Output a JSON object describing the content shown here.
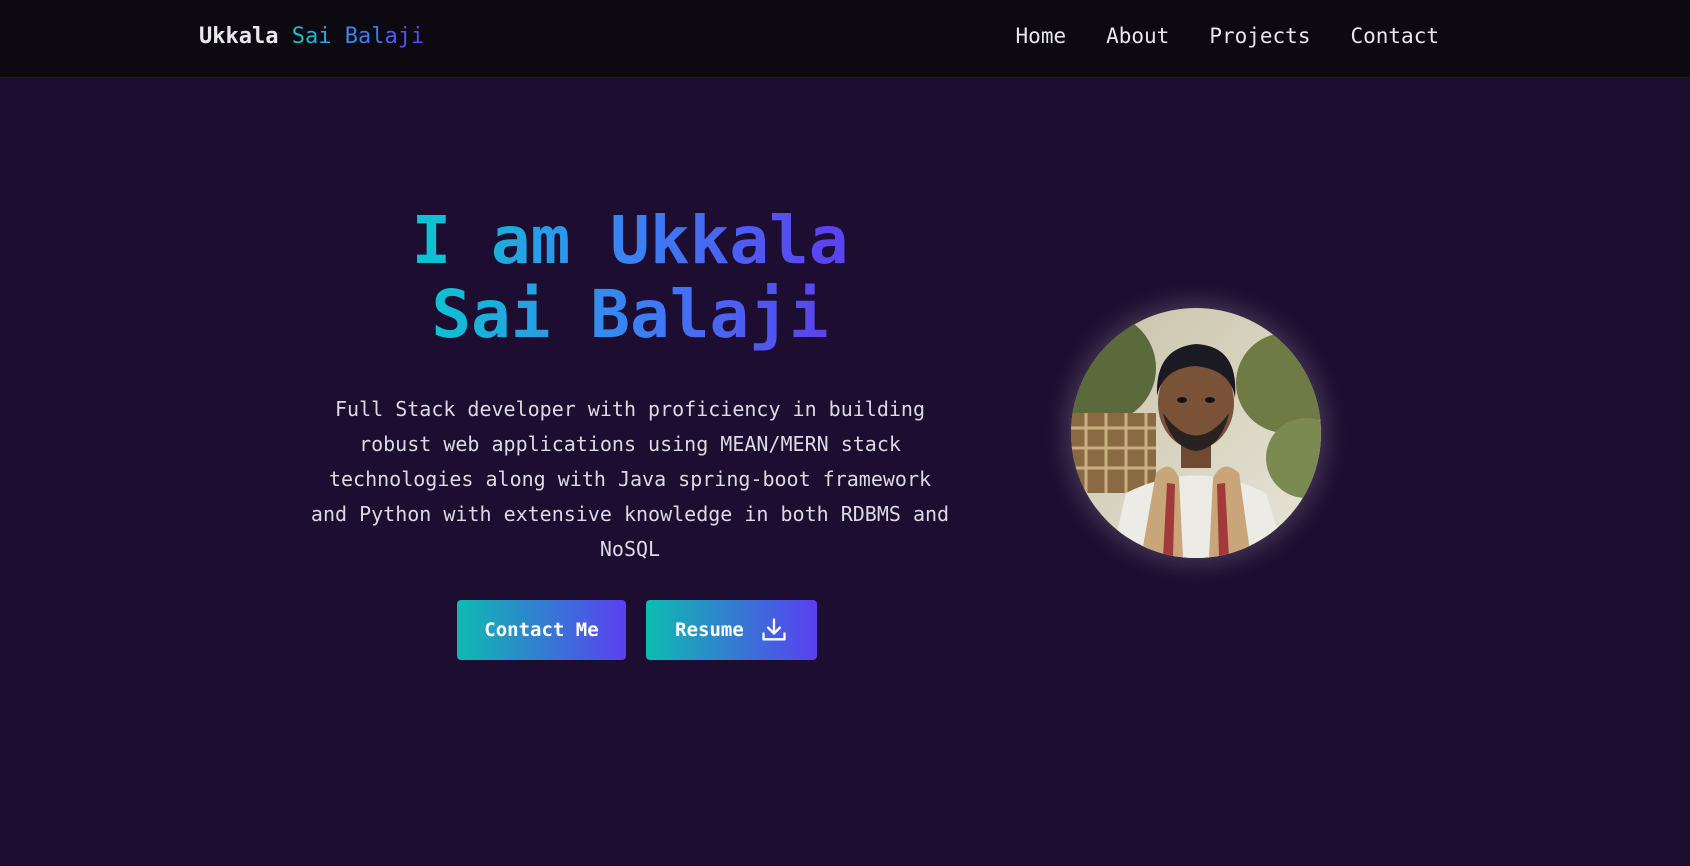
{
  "brand": {
    "first": "Ukkala",
    "highlight": "Sai Balaji"
  },
  "nav": {
    "items": [
      {
        "label": "Home"
      },
      {
        "label": "About"
      },
      {
        "label": "Projects"
      },
      {
        "label": "Contact"
      }
    ]
  },
  "hero": {
    "title_line1": "I am Ukkala",
    "title_line2": "Sai Balaji",
    "description": "Full Stack developer with proficiency in building robust web applications using MEAN/MERN stack technologies along with Java spring-boot framework and Python with extensive knowledge in both RDBMS and NoSQL",
    "contact_button": "Contact Me",
    "resume_button": "Resume"
  },
  "icons": {
    "resume": "download-icon",
    "avatar": "profile-photo"
  },
  "colors": {
    "background": "#1d0d30",
    "navbar": "#0c0a10",
    "gradient_start": "#0cbcb0",
    "gradient_end": "#5a3ff2"
  }
}
